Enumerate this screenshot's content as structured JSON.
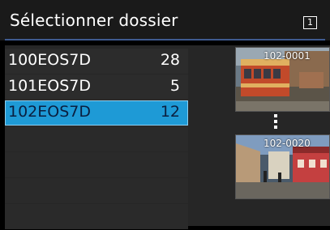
{
  "title": "Sélectionner dossier",
  "card_icon": "1",
  "folders": [
    {
      "name": "100EOS7D",
      "count": "28"
    },
    {
      "name": "101EOS7D",
      "count": "5"
    },
    {
      "name": "102EOS7D",
      "count": "12"
    }
  ],
  "selected_folder": "102EOS7D",
  "thumbnails": [
    {
      "label": "102-0001",
      "icon": "tram-photo"
    },
    {
      "label": "102-0020",
      "icon": "street-photo"
    }
  ],
  "colors": {
    "accent": "#1e9ad6",
    "title_rule": "#3f5a8f",
    "background": "#000000"
  }
}
